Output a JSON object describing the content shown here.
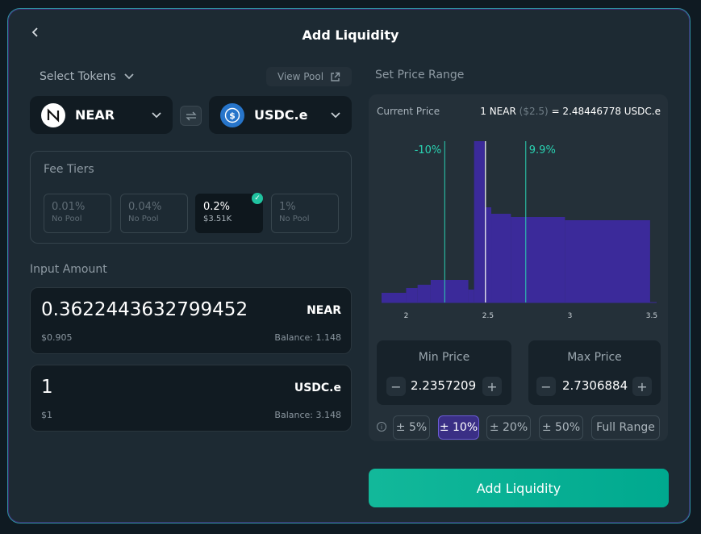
{
  "header": {
    "title": "Add Liquidity"
  },
  "tokens": {
    "select_label": "Select Tokens",
    "view_pool": "View Pool",
    "token_a": {
      "symbol": "NEAR"
    },
    "token_b": {
      "symbol": "USDC.e"
    }
  },
  "fee_tiers": {
    "title": "Fee Tiers",
    "items": [
      {
        "pct": "0.01%",
        "sub": "No Pool",
        "selected": false
      },
      {
        "pct": "0.04%",
        "sub": "No Pool",
        "selected": false
      },
      {
        "pct": "0.2%",
        "sub": "$3.51K",
        "selected": true
      },
      {
        "pct": "1%",
        "sub": "No Pool",
        "selected": false
      }
    ]
  },
  "input_amount": {
    "label": "Input Amount",
    "a": {
      "value": "0.3622443632799452",
      "token": "NEAR",
      "usd": "$0.905",
      "balance": "Balance: 1.148"
    },
    "b": {
      "value": "1",
      "token": "USDC.e",
      "usd": "$1",
      "balance": "Balance: 3.148"
    }
  },
  "price_range": {
    "label": "Set Price Range",
    "current_label": "Current Price",
    "current_left": "1 NEAR",
    "current_usd": "($2.5)",
    "current_right": "= 2.48446778 USDC.e",
    "min_label": "Min Price",
    "min_value": "2.2357209",
    "max_label": "Max Price",
    "max_value": "2.7306884",
    "buttons": [
      "± 5%",
      "± 10%",
      "± 20%",
      "± 50%",
      "Full Range"
    ],
    "active_button": 1
  },
  "chart_data": {
    "type": "bar",
    "x_ticks": [
      "2",
      "2.5",
      "3",
      "3.5"
    ],
    "xlim": [
      1.85,
      3.52
    ],
    "bars": [
      {
        "x0": 1.85,
        "x1": 2.0,
        "h": 0.06
      },
      {
        "x0": 2.0,
        "x1": 2.07,
        "h": 0.09
      },
      {
        "x0": 2.07,
        "x1": 2.15,
        "h": 0.11
      },
      {
        "x0": 2.15,
        "x1": 2.38,
        "h": 0.14
      },
      {
        "x0": 2.38,
        "x1": 2.415,
        "h": 0.08
      },
      {
        "x0": 2.415,
        "x1": 2.48,
        "h": 1.0
      },
      {
        "x0": 2.48,
        "x1": 2.49,
        "h": 0.59
      },
      {
        "x0": 2.49,
        "x1": 2.52,
        "h": 0.59
      },
      {
        "x0": 2.52,
        "x1": 2.64,
        "h": 0.55
      },
      {
        "x0": 2.64,
        "x1": 2.97,
        "h": 0.53
      },
      {
        "x0": 2.97,
        "x1": 3.49,
        "h": 0.51
      }
    ],
    "min_line": {
      "x": 2.2357209,
      "label": "-10%"
    },
    "max_line": {
      "x": 2.7306884,
      "label": "9.9%"
    },
    "current_line": {
      "x": 2.48446778
    },
    "colors": {
      "bar": "#3b2a9a",
      "range_line": "#2ad2b2",
      "current_line": "#ffffff"
    }
  },
  "actions": {
    "add": "Add Liquidity"
  }
}
